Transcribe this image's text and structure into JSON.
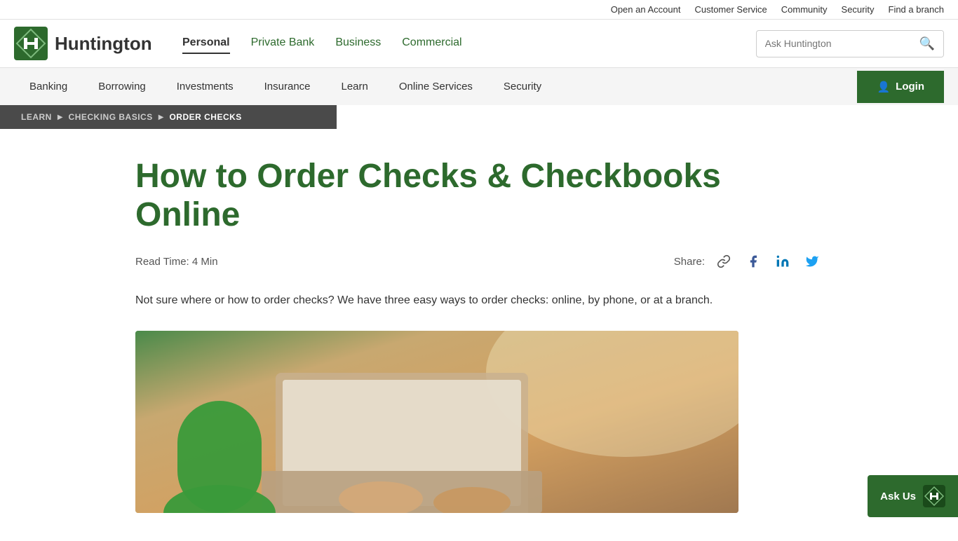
{
  "utility_bar": {
    "links": [
      {
        "label": "Open an Account",
        "name": "open-account-link"
      },
      {
        "label": "Customer Service",
        "name": "customer-service-link"
      },
      {
        "label": "Community",
        "name": "community-link"
      },
      {
        "label": "Security",
        "name": "security-utility-link"
      },
      {
        "label": "Find a branch",
        "name": "find-branch-link"
      }
    ]
  },
  "header": {
    "logo_text": "Huntington",
    "nav": [
      {
        "label": "Personal",
        "active": true,
        "name": "nav-personal"
      },
      {
        "label": "Private Bank",
        "active": false,
        "name": "nav-private-bank"
      },
      {
        "label": "Business",
        "active": false,
        "name": "nav-business"
      },
      {
        "label": "Commercial",
        "active": false,
        "name": "nav-commercial"
      }
    ],
    "search_placeholder": "Ask Huntington"
  },
  "secondary_nav": {
    "links": [
      {
        "label": "Banking",
        "name": "nav-banking"
      },
      {
        "label": "Borrowing",
        "name": "nav-borrowing"
      },
      {
        "label": "Investments",
        "name": "nav-investments"
      },
      {
        "label": "Insurance",
        "name": "nav-insurance"
      },
      {
        "label": "Learn",
        "name": "nav-learn"
      },
      {
        "label": "Online Services",
        "name": "nav-online-services"
      },
      {
        "label": "Security",
        "name": "nav-security"
      }
    ],
    "login_label": "Login"
  },
  "breadcrumb": {
    "items": [
      {
        "label": "LEARN",
        "name": "breadcrumb-learn"
      },
      {
        "label": "CHECKING BASICS",
        "name": "breadcrumb-checking-basics"
      },
      {
        "label": "ORDER CHECKS",
        "name": "breadcrumb-order-checks"
      }
    ]
  },
  "article": {
    "title": "How to Order Checks & Checkbooks Online",
    "read_time": "Read Time: 4 Min",
    "share_label": "Share:",
    "intro": "Not sure where or how to order checks? We have three easy ways to order checks: online, by phone, or at a branch."
  },
  "ask_us": {
    "label": "Ask Us"
  },
  "colors": {
    "primary_green": "#2d6a2d",
    "dark_nav": "#4a4a4a",
    "breadcrumb_bg": "#4a4a4a"
  }
}
